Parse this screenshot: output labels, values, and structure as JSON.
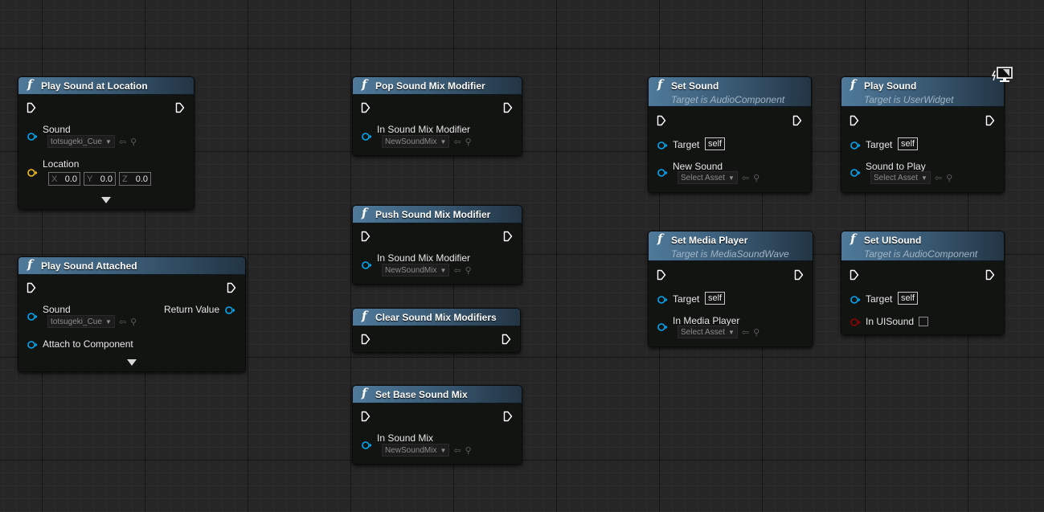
{
  "nodes": {
    "play_sound_at_location": {
      "title": "Play Sound at Location",
      "sound_label": "Sound",
      "sound_value": "totsugeki_Cue",
      "location_label": "Location",
      "x_axis": "X",
      "x_value": "0.0",
      "y_axis": "Y",
      "y_value": "0.0",
      "z_axis": "Z",
      "z_value": "0.0"
    },
    "play_sound_attached": {
      "title": "Play Sound Attached",
      "sound_label": "Sound",
      "sound_value": "totsugeki_Cue",
      "return_label": "Return Value",
      "attach_label": "Attach to Component"
    },
    "pop_sound_mix_modifier": {
      "title": "Pop Sound Mix Modifier",
      "param_label": "In Sound Mix Modifier",
      "param_value": "NewSoundMix"
    },
    "push_sound_mix_modifier": {
      "title": "Push Sound Mix Modifier",
      "param_label": "In Sound Mix Modifier",
      "param_value": "NewSoundMix"
    },
    "clear_sound_mix_modifiers": {
      "title": "Clear Sound Mix Modifiers"
    },
    "set_base_sound_mix": {
      "title": "Set Base Sound Mix",
      "param_label": "In Sound Mix",
      "param_value": "NewSoundMix"
    },
    "set_sound": {
      "title": "Set Sound",
      "subtitle": "Target is AudioComponent",
      "target_label": "Target",
      "target_value": "self",
      "param_label": "New Sound",
      "param_value": "Select Asset"
    },
    "play_sound": {
      "title": "Play Sound",
      "subtitle": "Target is UserWidget",
      "target_label": "Target",
      "target_value": "self",
      "param_label": "Sound to Play",
      "param_value": "Select Asset"
    },
    "set_media_player": {
      "title": "Set Media Player",
      "subtitle": "Target is MediaSoundWave",
      "target_label": "Target",
      "target_value": "self",
      "param_label": "In Media Player",
      "param_value": "Select Asset"
    },
    "set_uisound": {
      "title": "Set UISound",
      "subtitle": "Target is AudioComponent",
      "target_label": "Target",
      "target_value": "self",
      "param_label": "In UISound"
    }
  },
  "colors": {
    "object_pin": "#00a8f4",
    "struct_pin": "#f7c019",
    "bool_pin": "#950000",
    "exec_pin": "#ffffff",
    "header_accent": "#4f7a9a"
  },
  "icons": {
    "function": "function-icon",
    "widget": "widget-monitor-icon"
  }
}
